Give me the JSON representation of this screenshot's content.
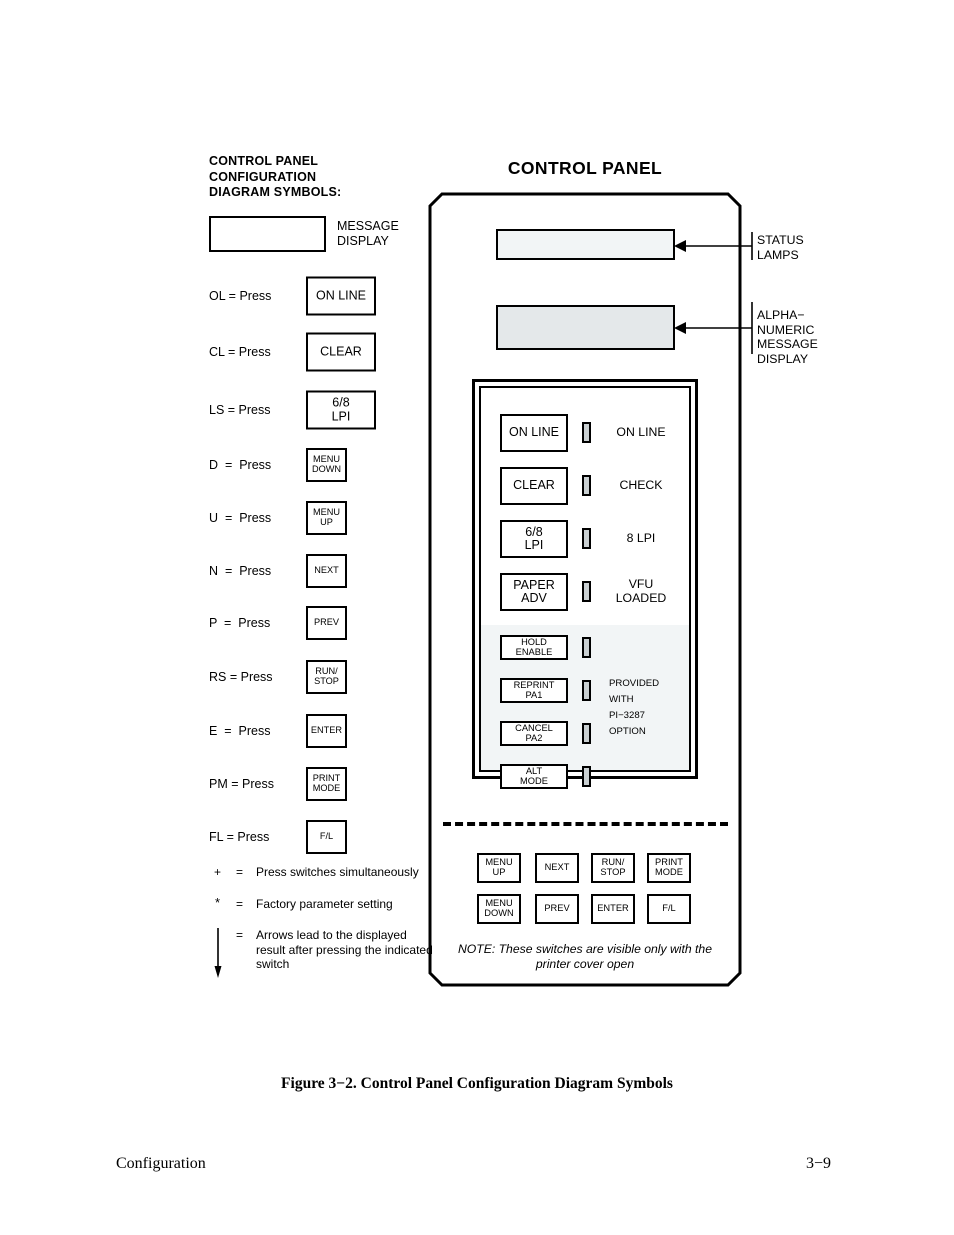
{
  "legend": {
    "heading_lines": [
      "CONTROL PANEL",
      "CONFIGURATION",
      "DIAGRAM SYMBOLS:"
    ],
    "message_display_label": "MESSAGE\nDISPLAY",
    "rows": [
      {
        "code": "OL = Press",
        "key": "ON LINE",
        "size": "big"
      },
      {
        "code": "CL = Press",
        "key": "CLEAR",
        "size": "big"
      },
      {
        "code": "LS = Press",
        "key": "6/8\nLPI",
        "size": "big"
      },
      {
        "code": "D  =  Press",
        "key": "MENU\nDOWN",
        "size": "small"
      },
      {
        "code": "U  =  Press",
        "key": "MENU\nUP",
        "size": "small"
      },
      {
        "code": "N  =  Press",
        "key": "NEXT",
        "size": "small"
      },
      {
        "code": "P  =  Press",
        "key": "PREV",
        "size": "small"
      },
      {
        "code": "RS = Press",
        "key": "RUN/\nSTOP",
        "size": "small"
      },
      {
        "code": "E  =  Press",
        "key": "ENTER",
        "size": "small"
      },
      {
        "code": "PM = Press",
        "key": "PRINT\nMODE",
        "size": "small"
      },
      {
        "code": "FL = Press",
        "key": "F/L",
        "size": "small"
      }
    ],
    "footnotes": {
      "plus_symbol": "+",
      "plus_equals": "=",
      "plus_text": "Press switches simultaneously",
      "star_symbol": "*",
      "star_equals": "=",
      "star_text": "Factory parameter setting",
      "arrow_equals": "=",
      "arrow_text": "Arrows lead to the displayed result after pressing the indicated switch"
    }
  },
  "panel": {
    "title": "CONTROL PANEL",
    "status_lamps_label": "STATUS\nLAMPS",
    "alpha_display_label": "ALPHA−\nNUMERIC\nMESSAGE\nDISPLAY",
    "main_keys": [
      {
        "key": "ON LINE",
        "led_label": "ON LINE"
      },
      {
        "key": "CLEAR",
        "led_label": "CHECK"
      },
      {
        "key": "6/8\nLPI",
        "led_label": "8 LPI"
      },
      {
        "key": "PAPER\nADV",
        "led_label": "VFU\nLOADED"
      }
    ],
    "option_keys": [
      {
        "key": "HOLD\nENABLE"
      },
      {
        "key": "REPRINT\nPA1"
      },
      {
        "key": "CANCEL\nPA2"
      },
      {
        "key": "ALT\nMODE"
      }
    ],
    "option_note_lines": [
      "PROVIDED",
      "WITH",
      "PI−3287",
      "OPTION"
    ],
    "hidden_keys_row1": [
      "MENU\nUP",
      "NEXT",
      "RUN/\nSTOP",
      "PRINT\nMODE"
    ],
    "hidden_keys_row2": [
      "MENU\nDOWN",
      "PREV",
      "ENTER",
      "F/L"
    ],
    "hidden_note": "NOTE: These switches are visible only with the printer cover open"
  },
  "caption": "Figure 3−2. Control Panel Configuration Diagram Symbols",
  "footer": {
    "left": "Configuration",
    "right": "3−9"
  },
  "colors": {
    "ink": "#000000",
    "status_fill": "#f2f5f6",
    "alpha_fill": "#e4e8ea",
    "led_fill": "#c9cfd1",
    "option_shade": "#f2f5f6"
  }
}
